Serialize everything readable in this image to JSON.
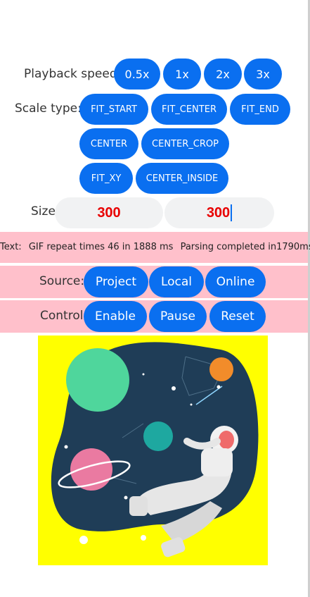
{
  "playback": {
    "label": "Playback speed",
    "options": [
      "0.5x",
      "1x",
      "2x",
      "3x"
    ]
  },
  "scale": {
    "label": "Scale type:",
    "options": [
      "FIT_START",
      "FIT_CENTER",
      "FIT_END",
      "CENTER",
      "CENTER_CROP",
      "FIT_XY",
      "CENTER_INSIDE"
    ]
  },
  "size": {
    "label": "Size",
    "width_value": "300",
    "height_value": "300"
  },
  "status": {
    "prefix": "Text:",
    "repeat": "GIF repeat times 46 in 1888 ms",
    "parse": "Parsing completed in1790ms"
  },
  "source": {
    "label": "Source:",
    "options": [
      "Project",
      "Local",
      "Online"
    ]
  },
  "control": {
    "label": "Control",
    "options": [
      "Enable",
      "Pause",
      "Reset"
    ]
  },
  "colors": {
    "accent": "#0a6ff0",
    "bar_background": "#ffc0cb",
    "size_text": "#e80000",
    "image_background": "#ffff00"
  },
  "image": {
    "subject": "astronaut-in-space-illustration"
  }
}
